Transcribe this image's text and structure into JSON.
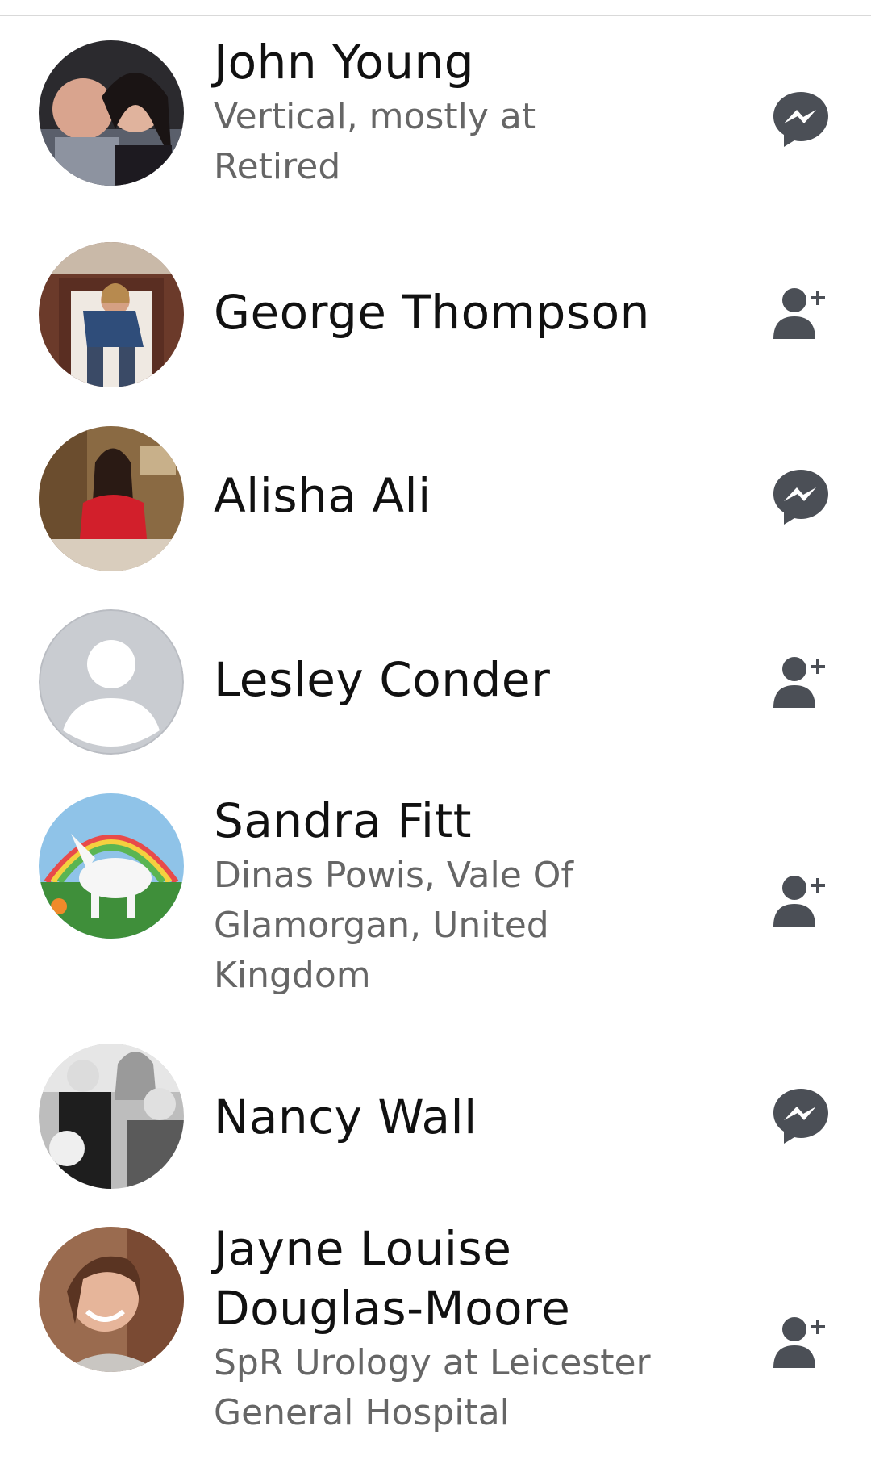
{
  "colors": {
    "name_text": "#111111",
    "sub_text": "#666666",
    "icon_gray": "#4b4f56",
    "divider": "#d9d9d9"
  },
  "people": [
    {
      "name": "John Young",
      "subtitle_lines": [
        "Vertical, mostly at",
        "Retired"
      ],
      "action_icon": "messenger-icon"
    },
    {
      "name": "George Thompson",
      "subtitle_lines": [],
      "action_icon": "add-friend-icon"
    },
    {
      "name": "Alisha Ali",
      "subtitle_lines": [],
      "action_icon": "messenger-icon"
    },
    {
      "name": "Lesley Conder",
      "subtitle_lines": [],
      "action_icon": "add-friend-icon"
    },
    {
      "name": "Sandra Fitt",
      "subtitle_lines": [
        "Dinas Powis, Vale Of",
        "Glamorgan, United",
        "Kingdom"
      ],
      "action_icon": "add-friend-icon"
    },
    {
      "name": "Nancy Wall",
      "subtitle_lines": [],
      "action_icon": "messenger-icon"
    },
    {
      "name": "Jayne Louise Douglas-Moore",
      "name_lines": [
        "Jayne Louise",
        "Douglas-Moore"
      ],
      "subtitle_lines": [
        "SpR Urology at Leicester",
        "General Hospital"
      ],
      "action_icon": "add-friend-icon"
    }
  ]
}
